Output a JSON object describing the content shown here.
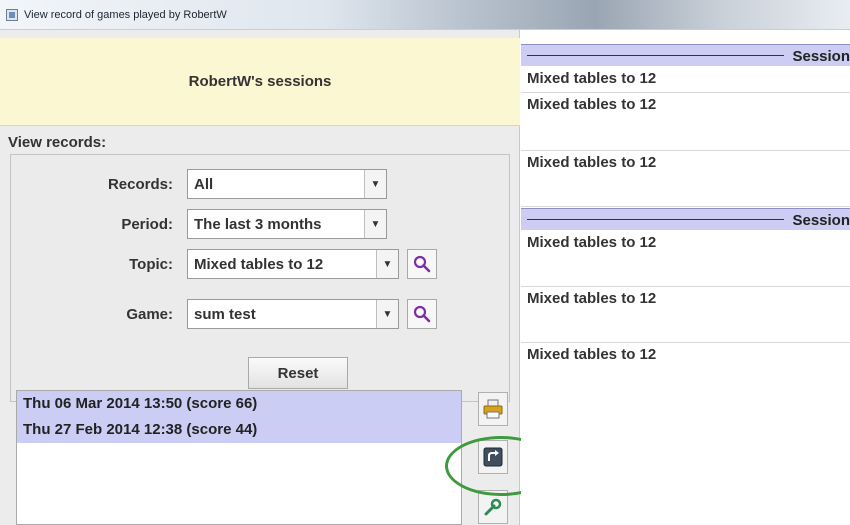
{
  "window": {
    "title": "View record of games played by RobertW"
  },
  "header": {
    "heading": "RobertW's sessions"
  },
  "filters": {
    "section_label": "View records:",
    "records": {
      "label": "Records:",
      "value": "All"
    },
    "period": {
      "label": "Period:",
      "value": "The last 3 months"
    },
    "topic": {
      "label": "Topic:",
      "value": "Mixed tables to 12"
    },
    "game": {
      "label": "Game:",
      "value": "sum test"
    },
    "reset_label": "Reset"
  },
  "sessions": [
    {
      "label": "Thu 06 Mar 2014  13:50 (score  66)"
    },
    {
      "label": "Thu 27 Feb 2014  12:38 (score  44)"
    }
  ],
  "side_buttons": [
    {
      "icon": "printer-icon"
    },
    {
      "icon": "export-icon"
    },
    {
      "icon": "wrench-icon"
    }
  ],
  "detail": {
    "session_header_label": "Session",
    "group1": [
      "Mixed tables to 12",
      "Mixed tables to 12",
      "Mixed tables to 12"
    ],
    "group2": [
      "Mixed tables to 12",
      "Mixed tables to 12",
      "Mixed tables to 12"
    ]
  },
  "colors": {
    "header_bg": "#fbf7d3",
    "selection_bg": "#cccdf5",
    "highlight_ring": "#3d9a3d"
  }
}
